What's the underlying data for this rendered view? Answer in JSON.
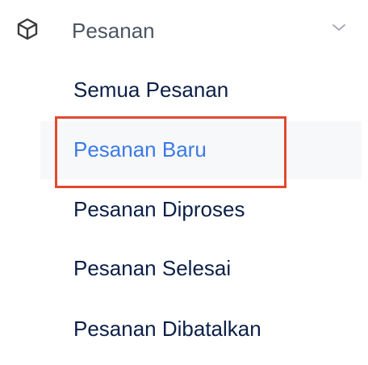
{
  "menu": {
    "header": {
      "label": "Pesanan",
      "icon": "cube-icon",
      "expand_icon": "chevron-down-icon"
    },
    "items": [
      {
        "label": "Semua Pesanan",
        "active": false
      },
      {
        "label": "Pesanan Baru",
        "active": true
      },
      {
        "label": "Pesanan Diproses",
        "active": false
      },
      {
        "label": "Pesanan Selesai",
        "active": false
      },
      {
        "label": "Pesanan Dibatalkan",
        "active": false
      }
    ]
  },
  "colors": {
    "text_default": "#0b1f47",
    "text_active": "#3b7ae6",
    "header_text": "#4b5563",
    "active_background": "#f7f8fa",
    "highlight_border": "#e2492f"
  }
}
